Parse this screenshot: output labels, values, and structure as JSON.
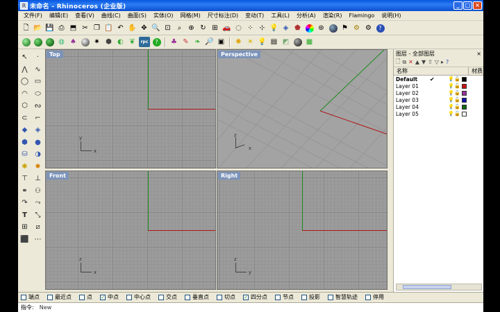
{
  "window": {
    "title": "未命名 - Rhinoceros (企业版)",
    "controls": [
      "_",
      "□",
      "×"
    ]
  },
  "menu": [
    "文件(F)",
    "编辑(E)",
    "查看(V)",
    "曲线(C)",
    "曲面(S)",
    "实体(O)",
    "网格(M)",
    "尺寸标注(D)",
    "变动(T)",
    "工具(L)",
    "分析(A)",
    "渲染(R)",
    "Flamingo",
    "说明(H)"
  ],
  "toolbar1": [
    "new-file-icon",
    "open-folder-icon",
    "save-icon",
    "print-icon",
    "import-icon",
    "cut-icon",
    "copy-icon",
    "paste-icon",
    "undo-icon",
    "pan-hand-icon",
    "move-view-icon",
    "zoom-icon",
    "zoom-window-icon",
    "zoom-dynamic-icon",
    "zoom-extents-icon",
    "rotate-view-icon",
    "four-viewports-icon",
    "car-icon",
    "hide-icon",
    "point-snap-icon",
    "selection-icon",
    "light-bulb-icon",
    "layer-icon",
    "material-icon",
    "color-wheel-icon",
    "render-settings-icon",
    "sphere-render-icon",
    "flag-icon",
    "gear-icon",
    "options-icon",
    "help-icon"
  ],
  "toolbar2_rpc": "rpc",
  "layers": {
    "panel_title": "图层 - 全部图层",
    "close": "×",
    "col_name": "名称",
    "col_material": "材质",
    "items": [
      {
        "name": "Default",
        "current": true,
        "color": "#000000",
        "check": "✔"
      },
      {
        "name": "Layer 01",
        "current": false,
        "color": "#cc1111",
        "check": ""
      },
      {
        "name": "Layer 02",
        "current": false,
        "color": "#993399",
        "check": ""
      },
      {
        "name": "Layer 03",
        "current": false,
        "color": "#1111aa",
        "check": ""
      },
      {
        "name": "Layer 04",
        "current": false,
        "color": "#116611",
        "check": ""
      },
      {
        "name": "Layer 05",
        "current": false,
        "color": "#ffffff",
        "check": ""
      }
    ]
  },
  "viewports": {
    "top": "Top",
    "perspective": "Perspective",
    "front": "Front",
    "right": "Right",
    "axis_x": "x",
    "axis_y": "y",
    "axis_z": "z"
  },
  "osnaps": [
    {
      "label": "端点",
      "checked": false
    },
    {
      "label": "最近点",
      "checked": false
    },
    {
      "label": "点",
      "checked": false
    },
    {
      "label": "中点",
      "checked": true
    },
    {
      "label": "中心点",
      "checked": false
    },
    {
      "label": "交点",
      "checked": false
    },
    {
      "label": "垂直点",
      "checked": false
    },
    {
      "label": "切点",
      "checked": false
    },
    {
      "label": "四分点",
      "checked": true
    },
    {
      "label": "节点",
      "checked": false
    },
    {
      "label": "投影",
      "checked": false
    },
    {
      "label": "智慧轨迹",
      "checked": false
    },
    {
      "label": "停用",
      "checked": false
    }
  ],
  "command": {
    "prompt": "指令:",
    "value": "New"
  },
  "colors": {
    "titlebar": "#0a58e0",
    "axis_x": "#b01818",
    "axis_y": "#1d8a1d",
    "viewport_bg": "#9c9c9c"
  }
}
